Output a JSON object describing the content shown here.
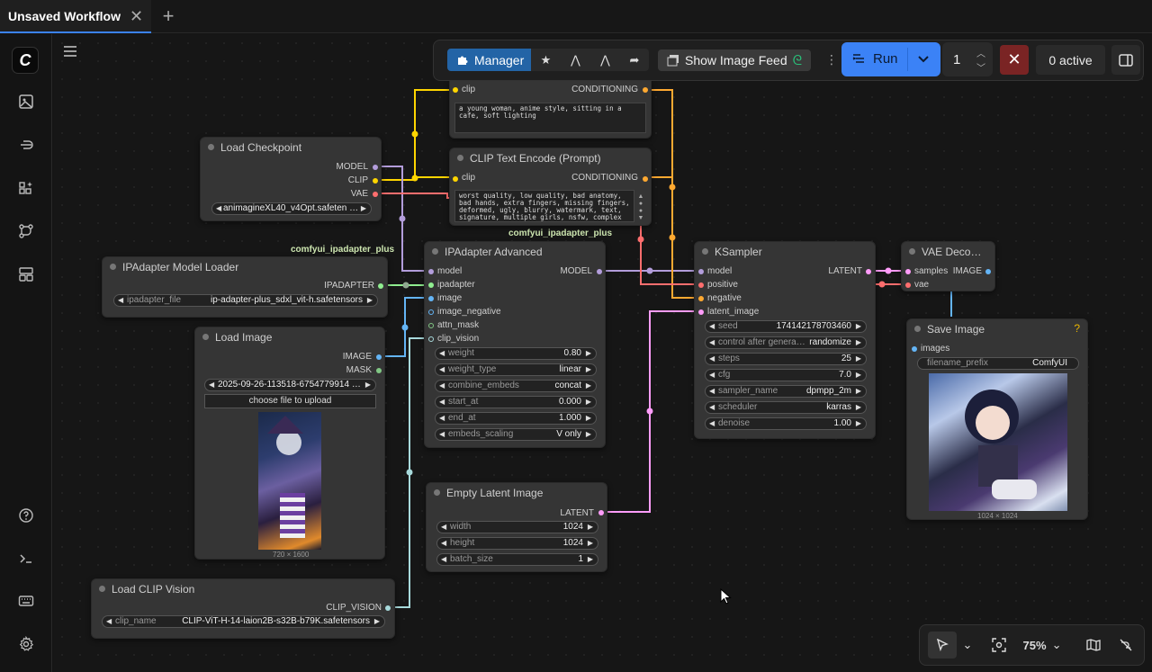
{
  "tab": {
    "title": "Unsaved Workflow"
  },
  "toolbar": {
    "manager_label": "Manager",
    "feed_label": "Show Image Feed",
    "run_label": "Run",
    "queue_count": "1",
    "active_label": "0 active",
    "zoom": "75%"
  },
  "groups": {
    "ipadapter_plus_1": "comfyui_ipadapter_plus",
    "ipadapter_plus_2": "comfyui_ipadapter_plus"
  },
  "nodes": {
    "clip_text_top": {
      "in_clip": "clip",
      "out": "CONDITIONING",
      "text": "a young woman, anime style, sitting in a cafe, soft lighting"
    },
    "clip_text_neg": {
      "title": "CLIP Text Encode (Prompt)",
      "in_clip": "clip",
      "out": "CONDITIONING",
      "text": "worst quality, low quality, bad anatomy, bad hands, extra fingers, missing fingers, deformed, ugly, blurry, watermark, text, signature, multiple girls, nsfw, complex background, dark background"
    },
    "load_checkpoint": {
      "title": "Load Checkpoint",
      "out_model": "MODEL",
      "out_clip": "CLIP",
      "out_vae": "VAE",
      "ckpt_value": "animagineXL40_v4Opt.safeten …"
    },
    "ipadapter_loader": {
      "title": "IPAdapter Model Loader",
      "out": "IPADAPTER",
      "file_label": "ipadapter_file",
      "file_value": "ip-adapter-plus_sdxl_vit-h.safetensors"
    },
    "load_image": {
      "title": "Load Image",
      "out_image": "IMAGE",
      "out_mask": "MASK",
      "file_value": "2025-09-26-113518-6754779914 …",
      "upload_label": "choose file to upload",
      "caption": "720 × 1600"
    },
    "load_clip_vision": {
      "title": "Load CLIP Vision",
      "out": "CLIP_VISION",
      "name_label": "clip_name",
      "name_value": "CLIP-ViT-H-14-laion2B-s32B-b79K.safetensors"
    },
    "ipadapter_adv": {
      "title": "IPAdapter Advanced",
      "out": "MODEL",
      "inputs": [
        "model",
        "ipadapter",
        "image",
        "image_negative",
        "attn_mask",
        "clip_vision"
      ],
      "widgets": [
        {
          "label": "weight",
          "value": "0.80"
        },
        {
          "label": "weight_type",
          "value": "linear"
        },
        {
          "label": "combine_embeds",
          "value": "concat"
        },
        {
          "label": "start_at",
          "value": "0.000"
        },
        {
          "label": "end_at",
          "value": "1.000"
        },
        {
          "label": "embeds_scaling",
          "value": "V only"
        }
      ]
    },
    "empty_latent": {
      "title": "Empty Latent Image",
      "out": "LATENT",
      "widgets": [
        {
          "label": "width",
          "value": "1024"
        },
        {
          "label": "height",
          "value": "1024"
        },
        {
          "label": "batch_size",
          "value": "1"
        }
      ]
    },
    "ksampler": {
      "title": "KSampler",
      "out": "LATENT",
      "inputs": [
        "model",
        "positive",
        "negative",
        "latent_image"
      ],
      "widgets": [
        {
          "label": "seed",
          "value": "174142178703460"
        },
        {
          "label": "control after genera…",
          "value": "randomize"
        },
        {
          "label": "steps",
          "value": "25"
        },
        {
          "label": "cfg",
          "value": "7.0"
        },
        {
          "label": "sampler_name",
          "value": "dpmpp_2m"
        },
        {
          "label": "scheduler",
          "value": "karras"
        },
        {
          "label": "denoise",
          "value": "1.00"
        }
      ]
    },
    "vae_decode": {
      "title": "VAE Deco…",
      "in_samples": "samples",
      "in_vae": "vae",
      "out": "IMAGE"
    },
    "save_image": {
      "title": "Save Image",
      "badge": "?",
      "in_images": "images",
      "prefix_label": "filename_prefix",
      "prefix_value": "ComfyUI",
      "caption": "1024 × 1024"
    }
  },
  "colors": {
    "model": "#b39ddb",
    "clip": "#ffd500",
    "vae": "#ff6e6e",
    "ipadapter": "#90ee90",
    "image": "#64b5f6",
    "conditioning": "#ffa931",
    "latent": "#ff9cf9",
    "clip_vision": "#a8dadc",
    "run": "#3b82f6",
    "manager": "#2364a6"
  }
}
